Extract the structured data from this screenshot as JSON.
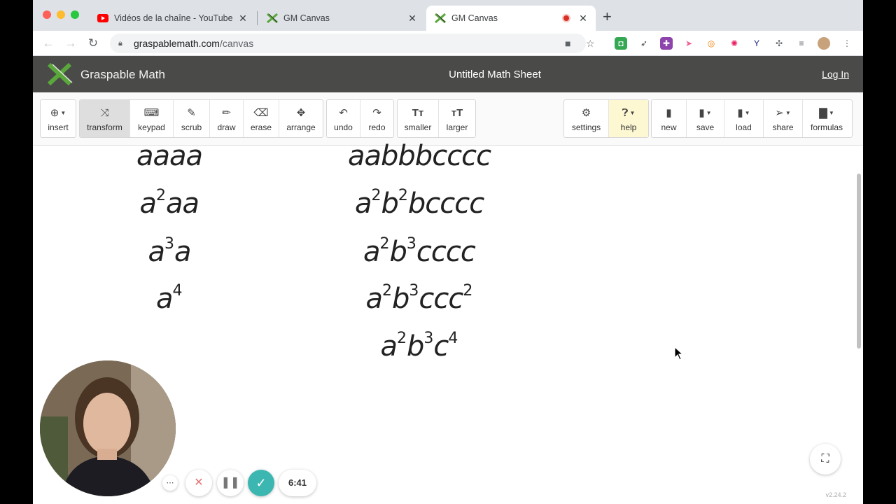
{
  "browser": {
    "tabs": [
      {
        "title": "Vidéos de la chaîne - YouTube",
        "active": false
      },
      {
        "title": "GM Canvas",
        "active": false
      },
      {
        "title": "GM Canvas",
        "active": true
      }
    ],
    "new_tab_label": "+",
    "url_host": "graspablemath.com",
    "url_path": "/canvas"
  },
  "header": {
    "app_name": "Graspable Math",
    "sheet_title": "Untitled Math Sheet",
    "login_label": "Log In"
  },
  "tools": {
    "insert": "insert",
    "transform": "transform",
    "keypad": "keypad",
    "scrub": "scrub",
    "draw": "draw",
    "erase": "erase",
    "arrange": "arrange",
    "undo": "undo",
    "redo": "redo",
    "smaller": "smaller",
    "larger": "larger",
    "settings": "settings",
    "help": "help",
    "new": "new",
    "save": "save",
    "load": "load",
    "share": "share",
    "formulas": "formulas"
  },
  "canvas": {
    "left_column": [
      {
        "base": "aaaa",
        "parts": [
          {
            "t": "aaaa"
          }
        ]
      },
      {
        "parts": [
          {
            "t": "a"
          },
          {
            "sup": "2"
          },
          {
            "t": "aa"
          }
        ]
      },
      {
        "parts": [
          {
            "t": "a"
          },
          {
            "sup": "3"
          },
          {
            "t": "a"
          }
        ]
      },
      {
        "parts": [
          {
            "t": "a"
          },
          {
            "sup": "4"
          }
        ]
      }
    ],
    "right_column": [
      {
        "parts": [
          {
            "t": "aabbbcccc"
          }
        ]
      },
      {
        "parts": [
          {
            "t": "a"
          },
          {
            "sup": "2"
          },
          {
            "t": "b"
          },
          {
            "sup": "2"
          },
          {
            "t": "bcccc"
          }
        ]
      },
      {
        "parts": [
          {
            "t": "a"
          },
          {
            "sup": "2"
          },
          {
            "t": "b"
          },
          {
            "sup": "3"
          },
          {
            "t": "cccc"
          }
        ]
      },
      {
        "parts": [
          {
            "t": "a"
          },
          {
            "sup": "2"
          },
          {
            "t": "b"
          },
          {
            "sup": "3"
          },
          {
            "t": "ccc"
          },
          {
            "sup": "2"
          }
        ]
      },
      {
        "parts": [
          {
            "t": "a"
          },
          {
            "sup": "2"
          },
          {
            "t": "b"
          },
          {
            "sup": "3"
          },
          {
            "t": "c"
          },
          {
            "sup": "4"
          }
        ]
      }
    ],
    "version": "v2.24.2"
  },
  "recorder": {
    "elapsed": "6:41"
  },
  "colors": {
    "header_bg": "#4a4a48",
    "logo_green": "#5aa83b",
    "confirm_teal": "#3cb6b0",
    "help_bg": "#fdf8d2"
  }
}
